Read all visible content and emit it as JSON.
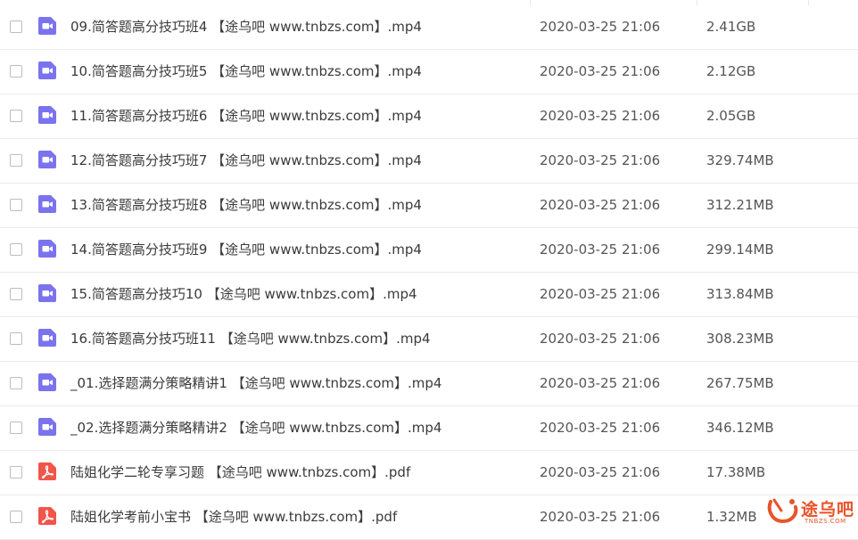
{
  "files": [
    {
      "name": "09.简答题高分技巧班4 【途乌吧 www.tnbzs.com】.mp4",
      "date": "2020-03-25 21:06",
      "size": "2.41GB",
      "type": "video",
      "icon": "video-file-icon"
    },
    {
      "name": "10.简答题高分技巧班5 【途乌吧 www.tnbzs.com】.mp4",
      "date": "2020-03-25 21:06",
      "size": "2.12GB",
      "type": "video",
      "icon": "video-file-icon"
    },
    {
      "name": "11.简答题高分技巧班6 【途乌吧 www.tnbzs.com】.mp4",
      "date": "2020-03-25 21:06",
      "size": "2.05GB",
      "type": "video",
      "icon": "video-file-icon"
    },
    {
      "name": "12.简答题高分技巧班7 【途乌吧 www.tnbzs.com】.mp4",
      "date": "2020-03-25 21:06",
      "size": "329.74MB",
      "type": "video",
      "icon": "video-file-icon"
    },
    {
      "name": "13.简答题高分技巧班8 【途乌吧 www.tnbzs.com】.mp4",
      "date": "2020-03-25 21:06",
      "size": "312.21MB",
      "type": "video",
      "icon": "video-file-icon"
    },
    {
      "name": "14.简答题高分技巧班9 【途乌吧 www.tnbzs.com】.mp4",
      "date": "2020-03-25 21:06",
      "size": "299.14MB",
      "type": "video",
      "icon": "video-file-icon"
    },
    {
      "name": "15.简答题高分技巧10 【途乌吧 www.tnbzs.com】.mp4",
      "date": "2020-03-25 21:06",
      "size": "313.84MB",
      "type": "video",
      "icon": "video-file-icon"
    },
    {
      "name": "16.简答题高分技巧班11 【途乌吧 www.tnbzs.com】.mp4",
      "date": "2020-03-25 21:06",
      "size": "308.23MB",
      "type": "video",
      "icon": "video-file-icon"
    },
    {
      "name": "_01.选择题满分策略精讲1 【途乌吧 www.tnbzs.com】.mp4",
      "date": "2020-03-25 21:06",
      "size": "267.75MB",
      "type": "video",
      "icon": "video-file-icon"
    },
    {
      "name": "_02.选择题满分策略精讲2 【途乌吧 www.tnbzs.com】.mp4",
      "date": "2020-03-25 21:06",
      "size": "346.12MB",
      "type": "video",
      "icon": "video-file-icon"
    },
    {
      "name": "陆姐化学二轮专享习题 【途乌吧 www.tnbzs.com】.pdf",
      "date": "2020-03-25 21:06",
      "size": "17.38MB",
      "type": "pdf",
      "icon": "pdf-file-icon"
    },
    {
      "name": "陆姐化学考前小宝书 【途乌吧 www.tnbzs.com】.pdf",
      "date": "2020-03-25 21:06",
      "size": "1.32MB",
      "type": "pdf",
      "icon": "pdf-file-icon"
    }
  ],
  "colors": {
    "video_icon": "#7b73ee",
    "pdf_icon": "#f2554a",
    "watermark": "#e8542a"
  },
  "watermark": {
    "text": "途乌吧",
    "sub": "TNBZS.COM"
  }
}
